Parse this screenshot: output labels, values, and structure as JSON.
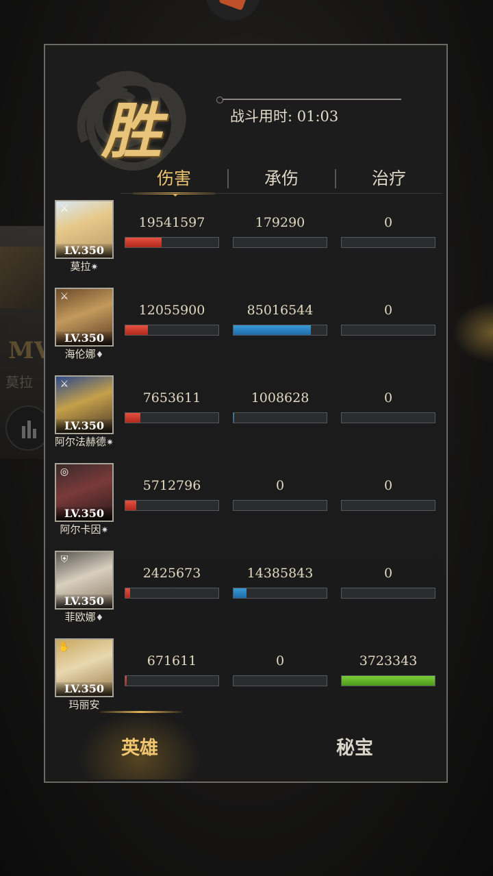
{
  "background": {
    "mvp_label": "MV",
    "mvp_name": "莫拉"
  },
  "header": {
    "result": "胜",
    "battle_time": "战斗用时: 01:03"
  },
  "tabs": [
    {
      "label": "伤害",
      "active": true
    },
    {
      "label": "承伤",
      "active": false
    },
    {
      "label": "治疗",
      "active": false
    }
  ],
  "colors": {
    "accent_gold": "#f0c570",
    "damage_bar": "#d5402f",
    "taken_bar": "#2e88c6",
    "heal_bar": "#6bbd2c"
  },
  "heroes": [
    {
      "name": "莫拉",
      "gem": "✷",
      "level": "LV.350",
      "class_icon": "sword-icon",
      "damage": "19541597",
      "damage_pct": 0.39,
      "taken": "179290",
      "taken_pct": 0.0,
      "heal": "0",
      "heal_pct": 0.0
    },
    {
      "name": "海伦娜",
      "gem": "♦",
      "level": "LV.350",
      "class_icon": "sword-icon",
      "damage": "12055900",
      "damage_pct": 0.24,
      "taken": "85016544",
      "taken_pct": 0.83,
      "heal": "0",
      "heal_pct": 0.0
    },
    {
      "name": "阿尔法赫德",
      "gem": "✷",
      "level": "LV.350",
      "class_icon": "sword-icon",
      "damage": "7653611",
      "damage_pct": 0.16,
      "taken": "1008628",
      "taken_pct": 0.01,
      "heal": "0",
      "heal_pct": 0.0
    },
    {
      "name": "阿尔卡因",
      "gem": "✷",
      "level": "LV.350",
      "class_icon": "swirl-icon",
      "damage": "5712796",
      "damage_pct": 0.12,
      "taken": "0",
      "taken_pct": 0.0,
      "heal": "0",
      "heal_pct": 0.0
    },
    {
      "name": "菲欧娜",
      "gem": "♦",
      "level": "LV.350",
      "class_icon": "shield-icon",
      "damage": "2425673",
      "damage_pct": 0.05,
      "taken": "14385843",
      "taken_pct": 0.14,
      "heal": "0",
      "heal_pct": 0.0
    },
    {
      "name": "玛丽安",
      "gem": "",
      "level": "LV.350",
      "class_icon": "hand-icon",
      "damage": "671611",
      "damage_pct": 0.015,
      "taken": "0",
      "taken_pct": 0.0,
      "heal": "3723343",
      "heal_pct": 1.0
    }
  ],
  "bottom_tabs": [
    {
      "label": "英雄",
      "active": true
    },
    {
      "label": "秘宝",
      "active": false
    }
  ]
}
